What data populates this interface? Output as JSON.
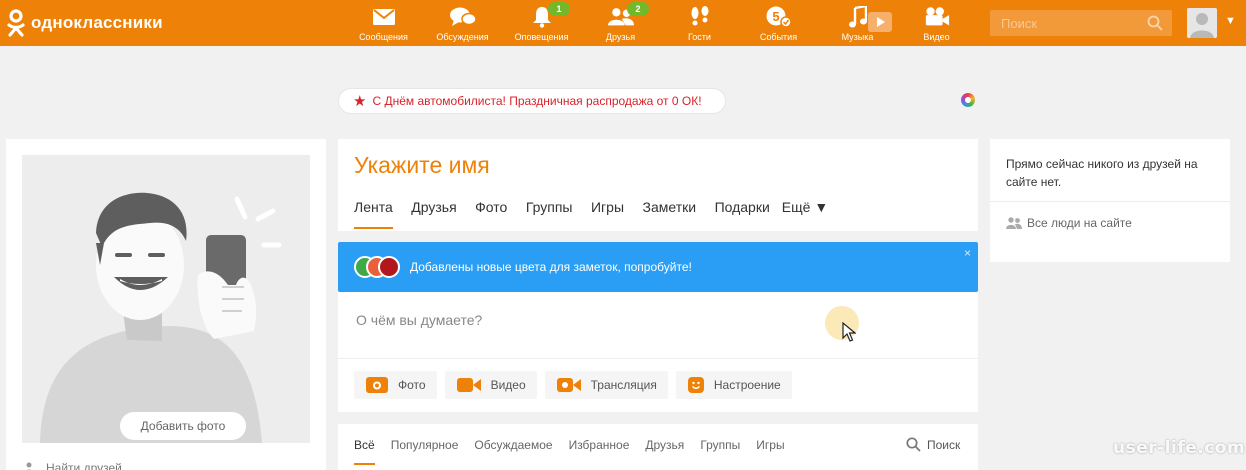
{
  "header": {
    "logo_text": "одноклассники",
    "nav": [
      {
        "label": "Сообщения",
        "icon": "envelope-icon",
        "badge": null
      },
      {
        "label": "Обсуждения",
        "icon": "discussions-icon",
        "badge": null
      },
      {
        "label": "Оповещения",
        "icon": "bell-icon",
        "badge": "1"
      },
      {
        "label": "Друзья",
        "icon": "friends-icon",
        "badge": "2"
      },
      {
        "label": "Гости",
        "icon": "footprints-icon",
        "badge": null
      },
      {
        "label": "События",
        "icon": "events-icon",
        "badge": null
      },
      {
        "label": "Музыка",
        "icon": "music-note-icon",
        "badge": null
      },
      {
        "label": "Видео",
        "icon": "video-camera-icon",
        "badge": null
      }
    ],
    "search_placeholder": "Поиск"
  },
  "promo": {
    "text": "С Днём автомобилиста! Праздничная распродажа от 0 ОК!"
  },
  "left": {
    "add_photo_label": "Добавить фото",
    "find_friends_label": "Найти друзей"
  },
  "profile": {
    "name": "Укажите имя",
    "tabs": [
      "Лента",
      "Друзья",
      "Фото",
      "Группы",
      "Игры",
      "Заметки",
      "Подарки",
      "Ещё ▼"
    ]
  },
  "tip": {
    "text": "Добавлены новые цвета для заметок, попробуйте!",
    "close": "×"
  },
  "composer": {
    "placeholder": "О чём вы думаете?",
    "actions": [
      "Фото",
      "Видео",
      "Трансляция",
      "Настроение"
    ]
  },
  "feed": {
    "tabs": [
      "Всё",
      "Популярное",
      "Обсуждаемое",
      "Избранное",
      "Друзья",
      "Группы",
      "Игры"
    ],
    "search_label": "Поиск"
  },
  "right": {
    "message": "Прямо сейчас никого из друзей на сайте нет.",
    "all_people_label": "Все люди на сайте"
  },
  "watermark": "user-life.com",
  "colors": {
    "brand_orange": "#ee8208",
    "badge_green": "#73b72b",
    "tip_blue": "#2a9ef5",
    "promo_red": "#d8232a"
  }
}
